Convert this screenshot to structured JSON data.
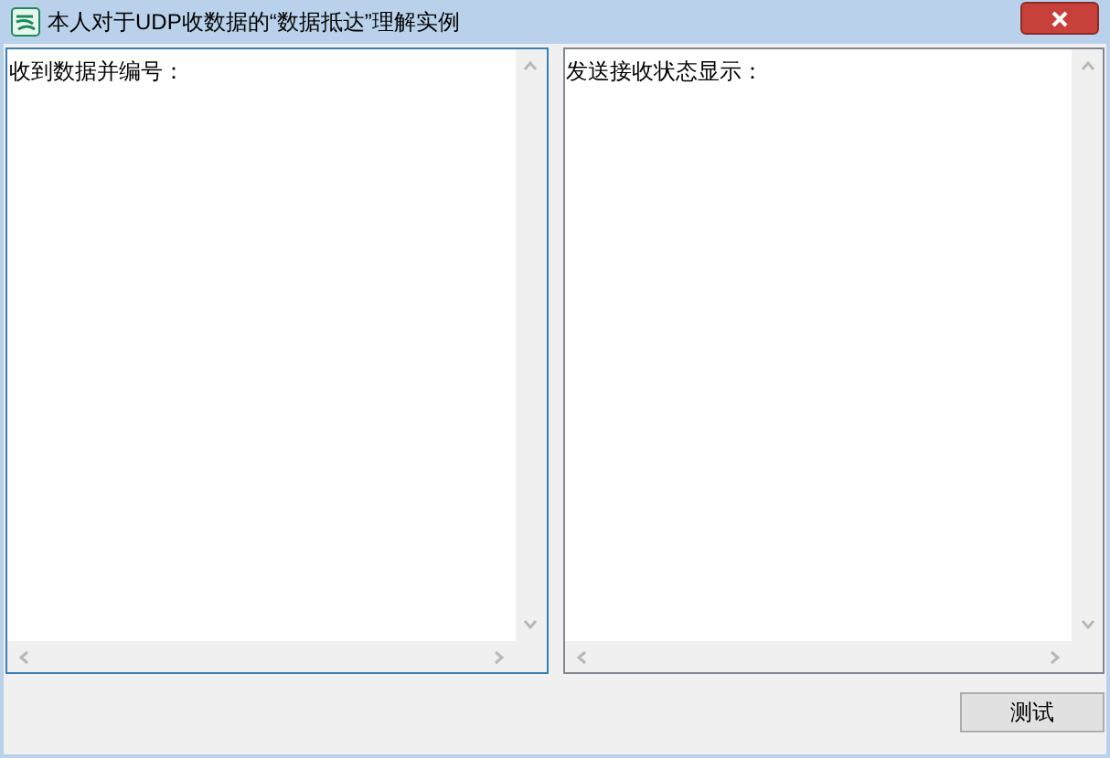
{
  "window": {
    "title": "本人对于UDP收数据的“数据抵达”理解实例"
  },
  "panes": [
    {
      "text": "收到数据并编号：",
      "focused": true
    },
    {
      "text": "发送接收状态显示：",
      "focused": false
    }
  ],
  "buttons": [
    "测试"
  ]
}
